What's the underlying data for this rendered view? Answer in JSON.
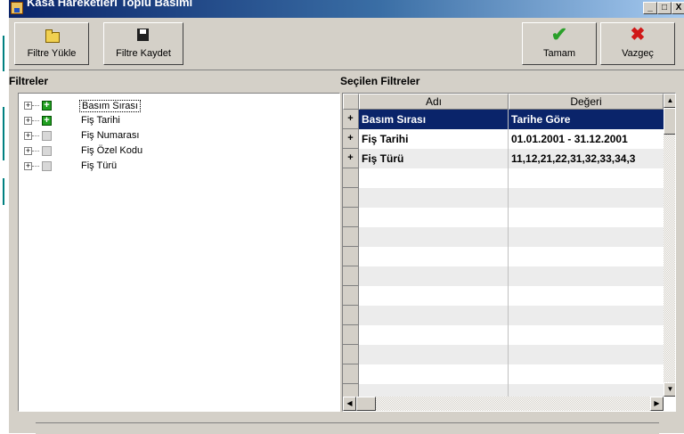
{
  "window": {
    "title": "Kasa Hareketleri Toplu Basımı"
  },
  "toolbar": {
    "load_filter": "Filtre Yükle",
    "save_filter": "Filtre Kaydet",
    "ok": "Tamam",
    "cancel": "Vazgeç"
  },
  "titlebar_buttons": {
    "minimize": "_",
    "maximize": "□",
    "close": "X"
  },
  "filters": {
    "label": "Filtreler",
    "items": [
      {
        "label": "Basım Sırası",
        "checked": true,
        "selected": true
      },
      {
        "label": "Fiş Tarihi",
        "checked": true
      },
      {
        "label": "Fiş Numarası",
        "checked": false
      },
      {
        "label": "Fiş Özel Kodu",
        "checked": false
      },
      {
        "label": "Fiş Türü",
        "checked": false
      }
    ]
  },
  "selected_filters": {
    "label": "Seçilen Filtreler",
    "columns": [
      "Adı",
      "Değeri"
    ],
    "rows": [
      {
        "indicator": "+",
        "name": "Basım Sırası",
        "value": "Tarihe Göre"
      },
      {
        "indicator": "+",
        "name": "Fiş Tarihi",
        "value": "01.01.2001 - 31.12.2001"
      },
      {
        "indicator": "+",
        "name": "Fiş Türü",
        "value": "11,12,21,22,31,32,33,34,3"
      }
    ]
  },
  "colors": {
    "title_bar": "#0a246a",
    "selection": "#0a246a",
    "check_on": "#20a020",
    "cancel_icon": "#d01818"
  }
}
